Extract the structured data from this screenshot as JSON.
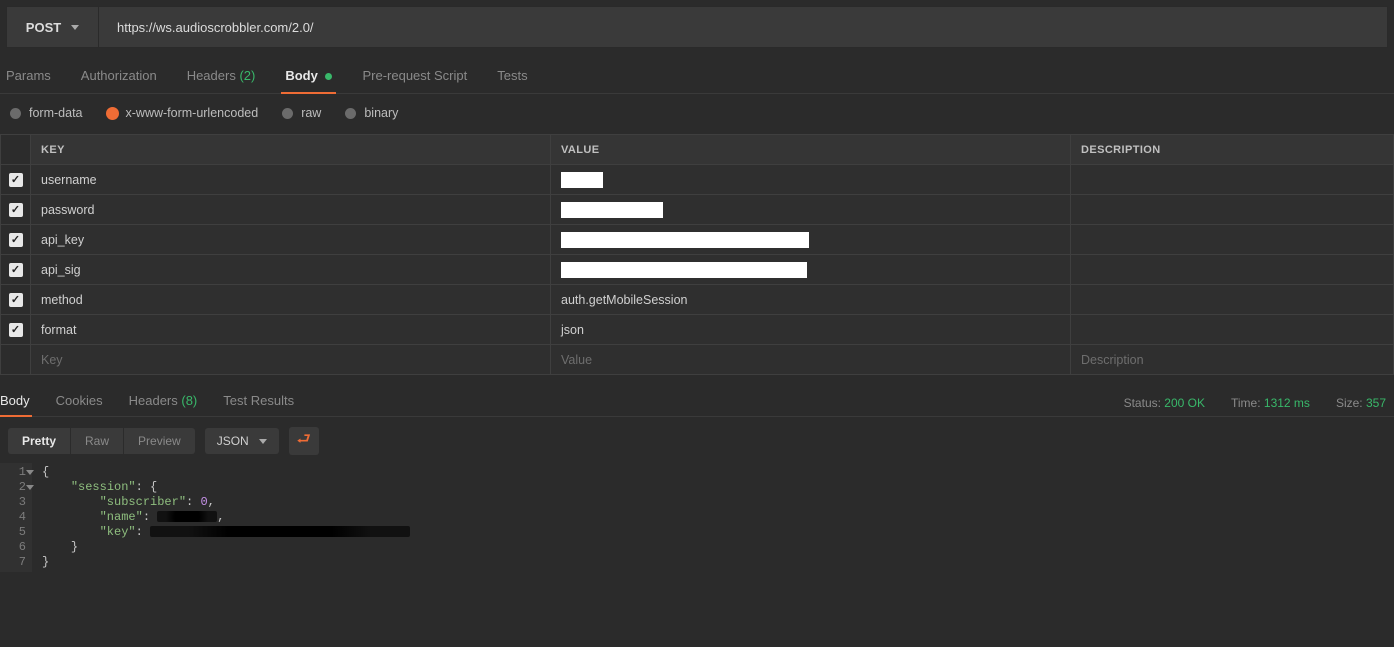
{
  "request": {
    "method": "POST",
    "url": "https://ws.audioscrobbler.com/2.0/"
  },
  "req_tabs": {
    "params": "Params",
    "auth": "Authorization",
    "headers": "Headers",
    "headers_count": "(2)",
    "body": "Body",
    "prereq": "Pre-request Script",
    "tests": "Tests"
  },
  "body_types": {
    "formdata": "form-data",
    "urlencoded": "x-www-form-urlencoded",
    "raw": "raw",
    "binary": "binary"
  },
  "kv": {
    "header_key": "KEY",
    "header_value": "VALUE",
    "header_desc": "DESCRIPTION",
    "placeholder_key": "Key",
    "placeholder_value": "Value",
    "placeholder_desc": "Description",
    "rows": [
      {
        "key": "username",
        "value": "",
        "redact_w": 42,
        "desc": ""
      },
      {
        "key": "password",
        "value": "",
        "redact_w": 102,
        "desc": ""
      },
      {
        "key": "api_key",
        "value": "",
        "redact_w": 248,
        "desc": ""
      },
      {
        "key": "api_sig",
        "value": "",
        "redact_w": 246,
        "desc": ""
      },
      {
        "key": "method",
        "value": "auth.getMobileSession",
        "redact_w": 0,
        "desc": ""
      },
      {
        "key": "format",
        "value": "json",
        "redact_w": 0,
        "desc": ""
      }
    ]
  },
  "resp_tabs": {
    "body": "Body",
    "cookies": "Cookies",
    "headers": "Headers",
    "headers_count": "(8)",
    "tests": "Test Results"
  },
  "resp_meta": {
    "status_lbl": "Status:",
    "status_val": "200 OK",
    "time_lbl": "Time:",
    "time_val": "1312 ms",
    "size_lbl": "Size:",
    "size_val": "357"
  },
  "resp_toolbar": {
    "pretty": "Pretty",
    "raw": "Raw",
    "preview": "Preview",
    "lang": "JSON"
  },
  "resp_json": {
    "session_key": "\"session\"",
    "subscriber_key": "\"subscriber\"",
    "subscriber_val": "0",
    "name_key": "\"name\"",
    "key_key": "\"key\""
  }
}
